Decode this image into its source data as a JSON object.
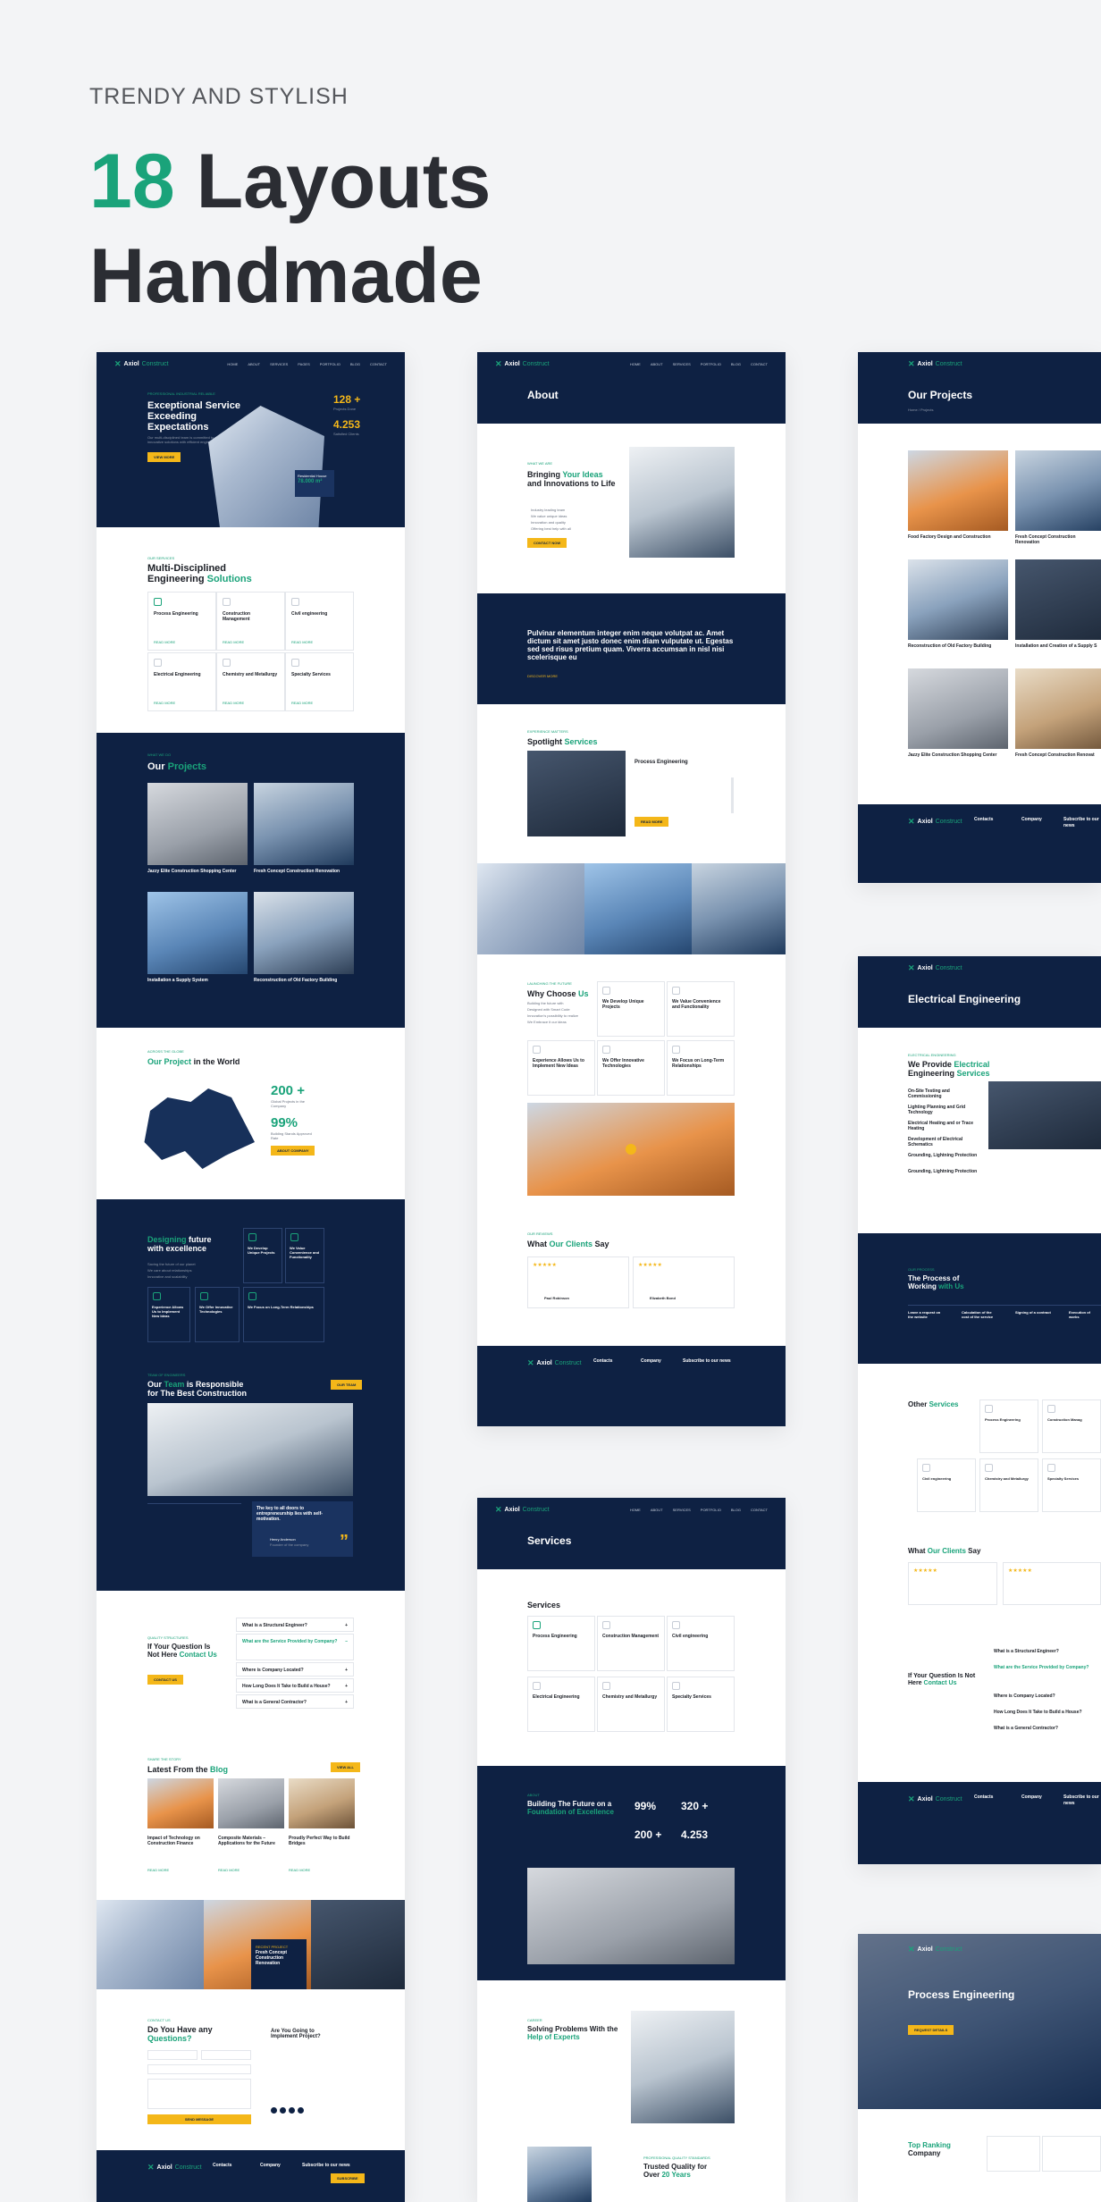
{
  "header": {
    "eyebrow": "TRENDY AND STYLISH",
    "number": "18",
    "word_layouts": "Layouts",
    "word_handmade": "Handmade"
  },
  "brand": {
    "name": "Axiol",
    "suffix": "Construct"
  },
  "nav": [
    "HOME",
    "ABOUT",
    "SERVICES",
    "PAGES",
    "PORTFOLIO",
    "BLOG",
    "CONTACT"
  ],
  "col1": {
    "hero_eyebrow": "PROFESSIONAL INDUSTRIAL RELIABLE",
    "hero_title": "Exceptional Service Exceeding Expectations",
    "hero_text": "Our multi-disciplined team is committed to providing innovative solutions with efficient engineering practices.",
    "hero_btn": "VIEW MORE",
    "stat1": "128 +",
    "stat1_label": "Projects Done",
    "stat2": "4.253",
    "stat2_label": "Satisfied Clients",
    "res_title": "Residential House",
    "res_value": "78.000 m²",
    "ms_eyebrow": "OUR SERVICES",
    "ms_title_a": "Multi-Disciplined",
    "ms_title_b": "Engineering",
    "ms_title_c": "Solutions",
    "services": [
      "Process Engineering",
      "Construction Management",
      "Civil engineering",
      "Electrical Engineering",
      "Chemistry and Metallurgy",
      "Specialty Services"
    ],
    "read_more": "READ MORE",
    "projects_eyebrow": "WHAT WE DO",
    "projects_a": "Our",
    "projects_b": "Projects",
    "projects": [
      "Jazzy Elite Construction Shopping Center",
      "Fresh Concept Construction Renovation",
      "Installation a Supply System",
      "Reconstruction of Old Factory Building"
    ],
    "world_eyebrow": "ACROSS THE GLOBE",
    "world_a": "Our",
    "world_b": "Project",
    "world_c": "in the World",
    "world_stat1": "200 +",
    "world_stat1_label": "Global Projects in the Company",
    "world_stat2": "99%",
    "world_stat2_label": "Building Stands Approved Rate",
    "world_btn": "ABOUT COMPANY",
    "future_a": "Designing",
    "future_b": "future with excellence",
    "future_items": [
      "We Develop Unique Projects",
      "We Value Convenience and Functionality",
      "Experience Allows Us to Implement New Ideas",
      "We Offer Innovative Technologies",
      "We Focus on Long-Term Relationships"
    ],
    "future_list": [
      "Saving the future of our planet",
      "We care about relationships",
      "Innovative and scalability"
    ],
    "team_eyebrow": "TEAM OF ENGINEERS",
    "team_a": "Our",
    "team_b": "Team",
    "team_c": "is Responsible for The Best Construction",
    "team_btn": "OUR TEAM",
    "team_quote": "The key to all doors to entrepreneurship lies with self-motivation.",
    "team_person": "Henry Anderson",
    "team_role": "Founder of the company",
    "faq_eyebrow": "QUALITY STRUCTURES",
    "faq_a": "If Your Question Is Not Here",
    "faq_b": "Contact Us",
    "faq_btn": "CONTACT US",
    "faq": [
      "What is a Structural Engineer?",
      "What are the Service Provided by Company?",
      "Where is Company Located?",
      "How Long Does It Take to Build a House?",
      "What is a General Contractor?"
    ],
    "blog_eyebrow": "SHARE THE STORY",
    "blog_a": "Latest From the",
    "blog_b": "Blog",
    "blog_btn": "VIEW ALL",
    "blog": [
      "Impact of Technology on Construction Finance",
      "Composite Materials – Applications for the Future",
      "Proudly Perfect Way to Build Bridges"
    ],
    "banner_eyebrow": "RECENT PROJECT",
    "banner_title": "Fresh Concept Construction Renovation",
    "contact_eyebrow": "CONTACT US",
    "contact_a": "Do You Have any",
    "contact_b": "Questions?",
    "contact_right": "Are You Going to Implement Project?",
    "contact_btn": "SEND MESSAGE",
    "footer_contact": "Contacts",
    "footer_company": "Company",
    "footer_sub": "Subscribe to our news",
    "footer_btn": "SUBSCRIBE"
  },
  "col2": {
    "about_title": "About",
    "about_eyebrow": "WHAT WE ARE",
    "about_a": "Bringing",
    "about_b": "Your Ideas",
    "about_c": "and Innovations to Life",
    "about_list": [
      "Industry leading team",
      "We value unique ideas",
      "Innovation and quality",
      "Offering best help with all"
    ],
    "about_btn": "CONTACT NOW",
    "quote": "Pulvinar elementum integer enim neque volutpat ac. Amet dictum sit amet justo donec enim diam vulputate ut. Egestas sed sed risus pretium quam. Viverra accumsan in nisl nisi scelerisque eu",
    "quote_link": "DISCOVER MORE",
    "spot_eyebrow": "EXPERIENCE MATTERS",
    "spot_a": "Spotlight",
    "spot_b": "Services",
    "spot_card": "Process Engineering",
    "spot_btn": "READ MORE",
    "why_eyebrow": "LAUNCHING THE FUTURE",
    "why_a": "Why Choose",
    "why_b": "Us",
    "why_items": [
      "We Develop Unique Projects",
      "We Value Convenience and Functionality",
      "Experience Allows Us to Implement New Ideas",
      "We Offer Innovative Technologies",
      "We Focus on Long-Term Relationships"
    ],
    "why_list": [
      "Building the future with",
      "Designed with Smart Code",
      "Innovation's possibility to realize",
      "We Embrace it our ideas"
    ],
    "test_eyebrow": "OUR REVIEWS",
    "test_a": "What",
    "test_b": "Our Clients",
    "test_c": "Say",
    "test_person1": "Paul Robinson",
    "test_person2": "Elizabeth Bond",
    "serv_title": "Services",
    "serv_sub": "Services",
    "services": [
      "Process Engineering",
      "Construction Management",
      "Civil engineering",
      "Electrical Engineering",
      "Chemistry and Metallurgy",
      "Specialty Services"
    ],
    "build_eyebrow": "ABOUT",
    "build_a": "Building The Future on a",
    "build_b": "Foundation of Excellence",
    "build_stats": [
      "99%",
      "320 +",
      "200 +",
      "4.253"
    ],
    "solve_eyebrow": "CAREER",
    "solve_a": "Solving Problems With the",
    "solve_b": "Help of Experts",
    "trusted_eyebrow": "PROFESSIONAL QUALITY STANDARDS",
    "trusted_a": "Trusted Quality for Over",
    "trusted_b": "20 Years"
  },
  "col3": {
    "proj_title": "Our Projects",
    "breadcrumb_home": "Home",
    "breadcrumb_cur": "Projects",
    "projects": [
      "Food Factory Design and Construction",
      "Fresh Concept Construction Renovation",
      "Reconstruction of Old Factory Building",
      "Installation and Creation of a Supply S",
      "Jazzy Elite Construction Shopping Center",
      "Fresh Concept Construction Renovat"
    ],
    "elec_title": "Electrical Engineering",
    "elec_eyebrow": "ELECTRICAL ENGINEERING",
    "elec_a": "We Provide",
    "elec_b": "Electrical",
    "elec_c": "Engineering",
    "elec_d": "Services",
    "elec_list": [
      "On-Site Testing and Commissioning",
      "Lighting Planning and Grid Technology",
      "Electrical Heating and or Trace Heating",
      "Development of Electrical Schematics",
      "Grounding, Lightning Protection",
      "Grounding, Lightning Protection"
    ],
    "process_eyebrow": "OUR PROCESS",
    "process_a": "The Process of Working",
    "process_b": "with Us",
    "process_steps": [
      "Leave a request on the website",
      "Calculation of the cost of the service",
      "Signing of a contract",
      "Execution of works"
    ],
    "other_a": "Other",
    "other_b": "Services",
    "other_services": [
      "Process Engineering",
      "Construction Manag",
      "Civil engineering",
      "Chemistry and Metallurgy",
      "Specialty Services"
    ],
    "test_a": "What",
    "test_b": "Our Clients",
    "test_c": "Say",
    "faq_a": "If Your Question Is Not Here",
    "faq_b": "Contact Us",
    "faq": [
      "What is a Structural Engineer?",
      "What are the Service Provided by Company?",
      "Where is Company Located?",
      "How Long Does It Take to Build a House?",
      "What is a General Contractor?"
    ],
    "pe_title": "Process Engineering",
    "pe_btn": "REQUEST DETAILS",
    "rank_a": "Top Ranking",
    "rank_b": "Company"
  },
  "colors": {
    "navy": "#0e2143",
    "green": "#1aa37a",
    "yellow": "#f4b719"
  }
}
